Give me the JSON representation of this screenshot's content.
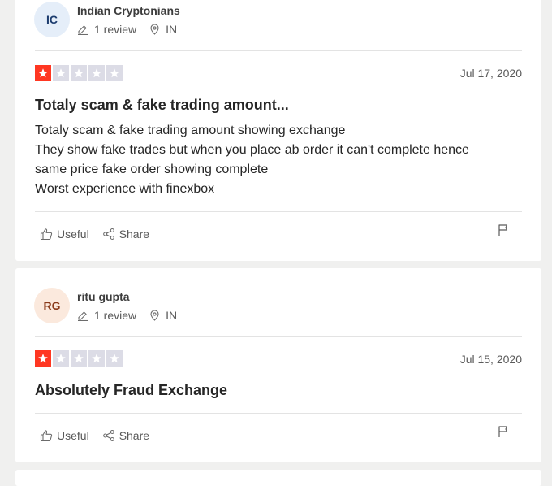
{
  "reviews": [
    {
      "avatar_initials": "IC",
      "avatar_bg": "#e5eef9",
      "avatar_fg": "#1c3c6e",
      "reviewer_name": "Indian Cryptonians",
      "review_count": "1 review",
      "location": "IN",
      "rating": 1,
      "date": "Jul 17, 2020",
      "title": "Totaly scam & fake trading amount...",
      "body_lines": [
        "Totaly scam & fake trading amount showing exchange",
        "They show fake trades but when you place ab order it can't complete hence",
        "same price fake order showing complete",
        "Worst experience with finexbox"
      ],
      "useful_label": "Useful",
      "share_label": "Share"
    },
    {
      "avatar_initials": "RG",
      "avatar_bg": "#fbe9dd",
      "avatar_fg": "#8a3a1a",
      "reviewer_name": "ritu gupta",
      "review_count": "1 review",
      "location": "IN",
      "rating": 1,
      "date": "Jul 15, 2020",
      "title": "Absolutely Fraud Exchange",
      "body_lines": [],
      "useful_label": "Useful",
      "share_label": "Share"
    }
  ],
  "colors": {
    "star_on": "#ff3722",
    "star_off": "#dcdce6",
    "page_bg": "#f0f0ef"
  }
}
